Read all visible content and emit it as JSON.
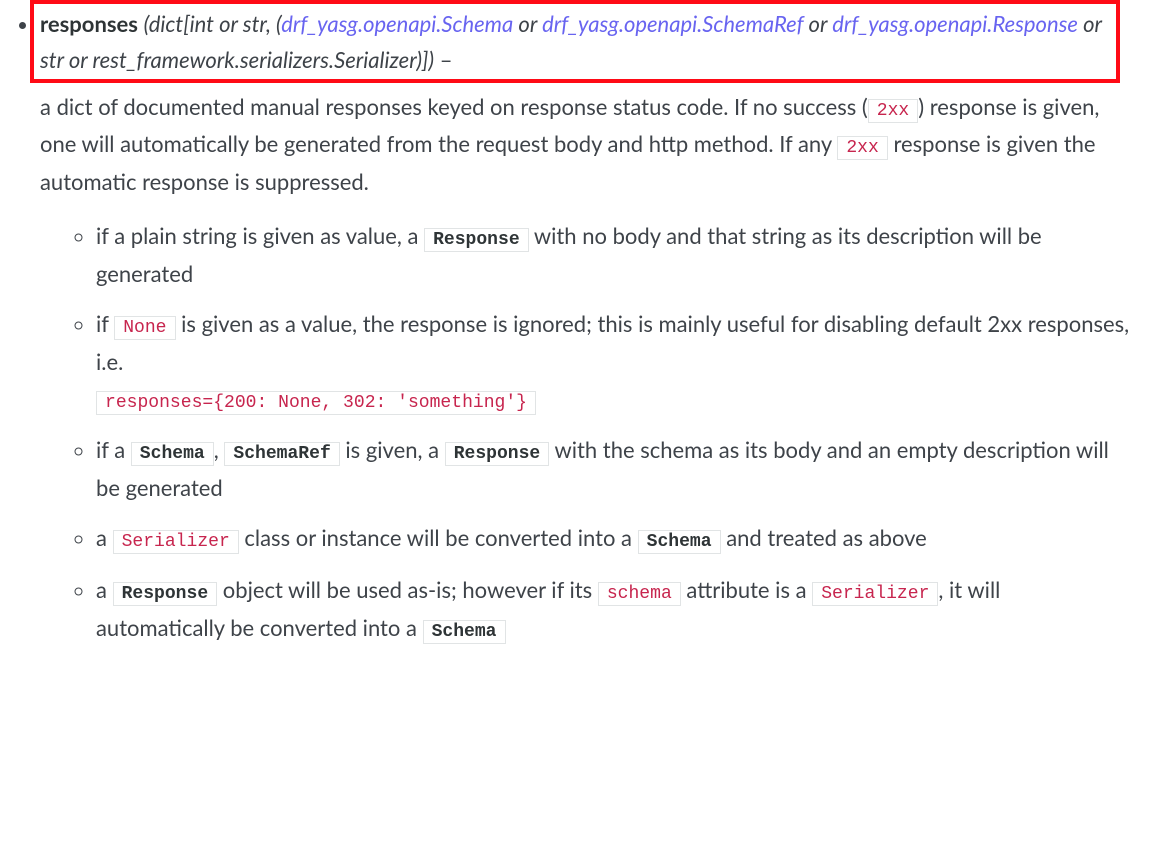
{
  "param": {
    "name": "responses",
    "typesig": {
      "open": "(",
      "prefix": "dict[int or str, (",
      "link1": "drf_yasg.openapi.Schema",
      "or1": " or ",
      "link2": "drf_yasg.openapi.SchemaRef",
      "or2": " or ",
      "link3": "drf_yasg.openapi.Response",
      "suffix": " or str or rest_framework.serializers.Serializer)]",
      "close": ")",
      "dash": " –"
    },
    "desc": {
      "p1a": "a dict of documented manual responses keyed on response status code. If no success (",
      "code_2xx": "2xx",
      "p1b": ") response is given, one will automatically be generated from the request body and http method. If any ",
      "p1c": " response is given the automatic response is suppressed."
    }
  },
  "subitems": [
    {
      "pre": "if a plain string is given as value, a ",
      "code1": "Response",
      "mid": " with no body and that string as its description will be generated"
    },
    {
      "pre": "if ",
      "code1": "None",
      "mid": " is given as a value, the response is ignored; this is mainly useful for disabling default 2xx responses, i.e. ",
      "code2": "responses={200: None, 302: 'something'}"
    },
    {
      "pre": "if a ",
      "code1": "Schema",
      "sep": ", ",
      "code2": "SchemaRef",
      "mid": " is given, a ",
      "code3": "Response",
      "post": " with the schema as its body and an empty description will be generated"
    },
    {
      "pre": "a ",
      "code1": "Serializer",
      "mid": " class or instance will be converted into a ",
      "code2": "Schema",
      "post": " and treated as above"
    },
    {
      "pre": "a ",
      "code1": "Response",
      "mid": " object will be used as-is; however if its ",
      "code2": "schema",
      "mid2": " attribute is a ",
      "code3": "Serializer",
      "post": ", it will automatically be converted into a ",
      "code4": "Schema"
    }
  ]
}
